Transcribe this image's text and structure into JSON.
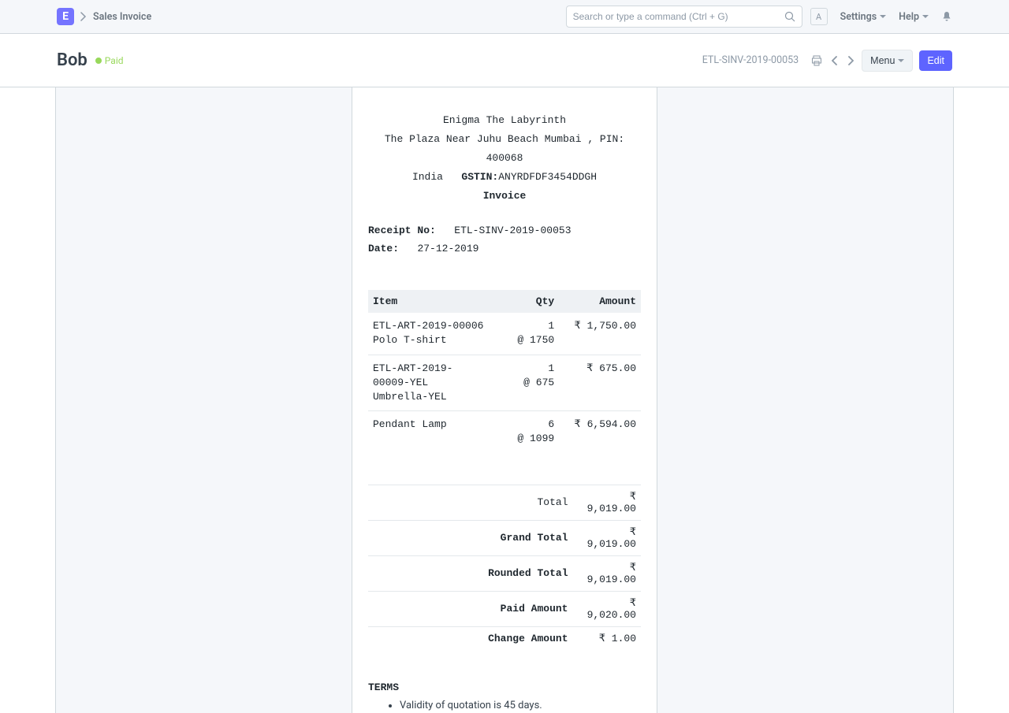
{
  "navbar": {
    "logo_letter": "E",
    "breadcrumb": "Sales Invoice",
    "search_placeholder": "Search or type a command (Ctrl + G)",
    "avatar_letter": "A",
    "settings_label": "Settings",
    "help_label": "Help"
  },
  "page_head": {
    "title": "Bob",
    "status_label": "Paid",
    "doc_id": "ETL-SINV-2019-00053",
    "menu_label": "Menu",
    "edit_label": "Edit"
  },
  "invoice": {
    "company": "Enigma The Labyrinth",
    "address": "The Plaza Near Juhu Beach Mumbai , PIN: 400068",
    "country": "India",
    "gstin_label": "GSTIN:",
    "gstin_value": "ANYRDFDF3454DDGH",
    "doc_heading": "Invoice",
    "receipt_label": "Receipt No:",
    "receipt_value": "ETL-SINV-2019-00053",
    "date_label": "Date:",
    "date_value": "27-12-2019",
    "headers": {
      "item": "Item",
      "qty": "Qty",
      "amount": "Amount"
    },
    "items": [
      {
        "code": "ETL-ART-2019-00006",
        "name": "Polo T-shirt",
        "qty": "1",
        "rate": "@ 1750",
        "amount": "₹ 1,750.00"
      },
      {
        "code": "ETL-ART-2019-00009-YEL",
        "name": "Umbrella-YEL",
        "qty": "1",
        "rate": "@ 675",
        "amount": "₹ 675.00"
      },
      {
        "code": "Pendant Lamp",
        "name": "",
        "qty": "6",
        "rate": "@ 1099",
        "amount": "₹ 6,594.00"
      }
    ],
    "totals": [
      {
        "label": "Total",
        "value": "₹ 9,019.00",
        "bold": false
      },
      {
        "label": "Grand Total",
        "value": "₹ 9,019.00",
        "bold": true
      },
      {
        "label": "Rounded Total",
        "value": "₹ 9,019.00",
        "bold": true
      },
      {
        "label": "Paid Amount",
        "value": "₹ 9,020.00",
        "bold": true
      },
      {
        "label": "Change Amount",
        "value": "₹ 1.00",
        "bold": true
      }
    ],
    "terms_heading": "TERMS",
    "terms": [
      "Validity of quotation is 45 days."
    ]
  }
}
